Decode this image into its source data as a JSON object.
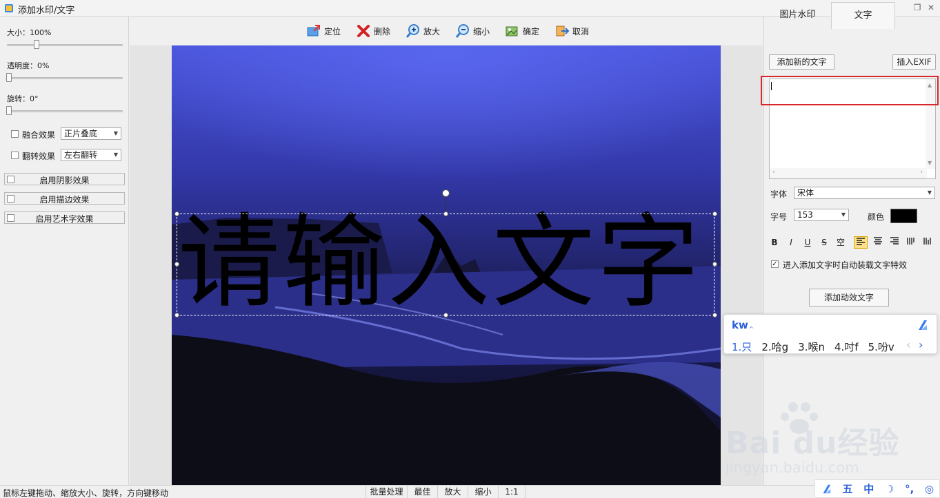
{
  "window": {
    "title": "添加水印/文字"
  },
  "left_panel": {
    "size_label": "大小：100%",
    "opacity_label": "透明度：0%",
    "rotation_label": "旋转：0°",
    "blend": {
      "label": "融合效果",
      "value": "正片叠底"
    },
    "flip": {
      "label": "翻转效果",
      "value": "左右翻转"
    },
    "buttons": [
      "启用阴影效果",
      "启用描边效果",
      "启用艺术字效果"
    ]
  },
  "toolbar": {
    "locate": "定位",
    "delete": "删除",
    "zoom_in": "放大",
    "zoom_out": "缩小",
    "confirm": "确定",
    "cancel": "取消"
  },
  "canvas": {
    "watermark_text": "请输入文字"
  },
  "right_panel": {
    "tabs": [
      "图片水印",
      "文字"
    ],
    "add_text_btn": "添加新的文字",
    "insert_exif_btn": "插入EXIF",
    "font_label": "字体",
    "font_value": "宋体",
    "size_label": "字号",
    "size_value": "153",
    "color_label": "颜色",
    "format_buttons": [
      "B",
      "I",
      "U",
      "S",
      "空"
    ],
    "auto_effect_label": "进入添加文字时自动装载文字特效",
    "add_anim_btn": "添加动效文字"
  },
  "ime": {
    "composition": "kw",
    "candidates": [
      "1.只",
      "2.哈g",
      "3.喉n",
      "4.吋f",
      "5.吩v"
    ],
    "tray": [
      "五",
      "中"
    ]
  },
  "statusbar": {
    "hint": "鼠标左键拖动、缩放大小、旋转，方向键移动",
    "buttons": [
      "批量处理",
      "最佳",
      "放大",
      "缩小",
      "1:1"
    ]
  },
  "watermark_logo": {
    "text": "Bai du经验",
    "url": "jingyan.baidu.com"
  },
  "colors": {
    "accent": "#2b5fd9",
    "highlight_red": "#d9262c",
    "photo_sky": "#4a55d8"
  }
}
